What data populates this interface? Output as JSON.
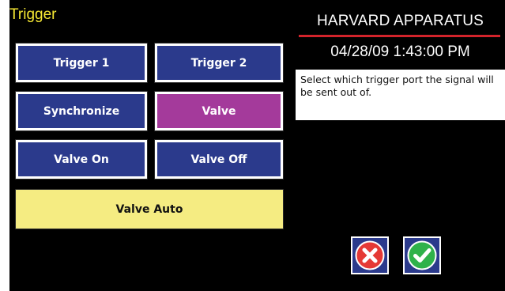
{
  "screen": {
    "title": "Trigger",
    "brand": "HARVARD APPARATUS",
    "datetime": "04/28/09 1:43:00 PM",
    "help_text": "Select which trigger port the signal will be sent out of."
  },
  "buttons": {
    "trigger1": "Trigger 1",
    "trigger2": "Trigger 2",
    "synchronize": "Synchronize",
    "valve": "Valve",
    "valve_on": "Valve On",
    "valve_off": "Valve Off",
    "valve_auto": "Valve Auto"
  },
  "state": {
    "selected": "Valve"
  },
  "colors": {
    "background": "#000000",
    "button_blue": "#2b3a8c",
    "selected_purple": "#a43a9b",
    "auto_yellow": "#f5ec82",
    "title_yellow": "#f6e833",
    "brand_red": "#d3232b",
    "cancel_red": "#e53935",
    "confirm_green": "#2fb24a"
  },
  "icons": {
    "cancel": "cancel-x-icon",
    "confirm": "confirm-check-icon"
  }
}
